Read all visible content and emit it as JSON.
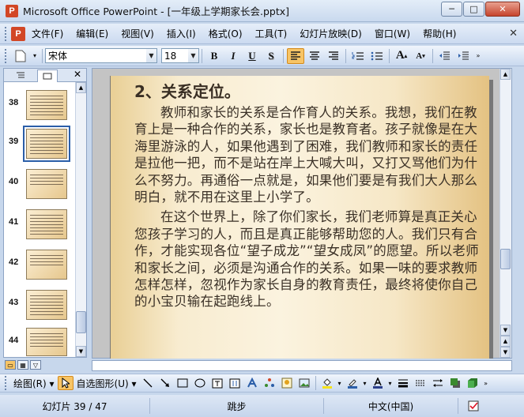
{
  "window": {
    "title": "Microsoft Office PowerPoint - [一年级上学期家长会.pptx]",
    "app_icon_letter": "P",
    "min_glyph": "─",
    "max_glyph": "□",
    "close_glyph": "✕"
  },
  "menubar": {
    "doc_icon_letter": "P",
    "items": [
      {
        "label": "文件(F)"
      },
      {
        "label": "编辑(E)"
      },
      {
        "label": "视图(V)"
      },
      {
        "label": "插入(I)"
      },
      {
        "label": "格式(O)"
      },
      {
        "label": "工具(T)"
      },
      {
        "label": "幻灯片放映(D)"
      },
      {
        "label": "窗口(W)"
      },
      {
        "label": "帮助(H)"
      }
    ],
    "close_glyph": "✕"
  },
  "toolbar": {
    "font_name": "宋体",
    "font_size": "18",
    "bold": "B",
    "italic": "I",
    "underline": "U",
    "shadow": "S",
    "grow_font": "A",
    "shrink_font": "A"
  },
  "slides_pane": {
    "current_index": 1,
    "thumbnails": [
      {
        "number": "38"
      },
      {
        "number": "39"
      },
      {
        "number": "40"
      },
      {
        "number": "41"
      },
      {
        "number": "42"
      },
      {
        "number": "43"
      },
      {
        "number": "44"
      }
    ]
  },
  "slide": {
    "heading": "2、关系定位。",
    "paragraph1": "教师和家长的关系是合作育人的关系。我想，我们在教育上是一种合作的关系，家长也是教育者。孩子就像是在大海里游泳的人，如果他遇到了困难，我们教师和家长的责任是拉他一把，而不是站在岸上大喊大叫，又打又骂他们为什么不努力。再通俗一点就是，如果他们要是有我们大人那么明白，就不用在这里上小学了。",
    "paragraph2": "在这个世界上，除了你们家长，我们老师算是真正关心您孩子学习的人，而且是真正能够帮助您的人。我们只有合作，才能实现各位“望子成龙”“望女成凤”的愿望。所以老师和家长之间，必须是沟通合作的关系。如果一味的要求教师怎样怎样，忽视作为家长自身的教育责任，最终将使你自己的小宝贝输在起跑线上。"
  },
  "drawbar": {
    "draw_label": "绘图(R)",
    "autoshapes_label": "自选图形(U)"
  },
  "statusbar": {
    "slide_position": "幻灯片 39 / 47",
    "design": "跳步",
    "language": "中文(中国)"
  }
}
